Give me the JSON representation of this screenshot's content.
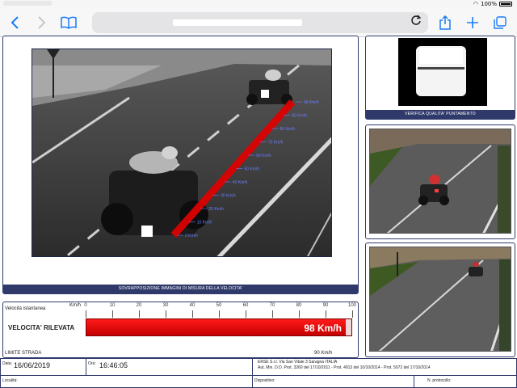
{
  "status": {
    "battery": "100%"
  },
  "toolbar": {
    "back_icon": "chevron-left-icon",
    "forward_icon": "chevron-right-icon",
    "bookmarks_icon": "book-icon",
    "reload_icon": "reload-icon",
    "share_icon": "share-icon",
    "new_tab_icon": "plus-icon",
    "tabs_icon": "tabs-icon",
    "accent": "#1a7cf5"
  },
  "report": {
    "main_caption": "SOVRAPPOSIZIONE IMMAGINI DI MISURA DELLA VELOCITA'",
    "aim_caption": "VERIFICA QUALITA' PUNTAMENTO",
    "distance_labels": [
      "98 Km/h",
      "90 Km/h",
      "80 Km/h",
      "70 Km/h",
      "60 Km/h",
      "50 Km/h",
      "40 Km/h",
      "30 Km/h",
      "20 Km/h",
      "10 Km/h",
      "0 Km/h"
    ],
    "instant_speed_label": "Velocità istantanea",
    "kmh_label": "Km/h",
    "scale_ticks": [
      "0",
      "10",
      "20",
      "30",
      "40",
      "50",
      "60",
      "70",
      "80",
      "90",
      "100"
    ],
    "detected_label": "VELOCITA' RILEVATA",
    "detected_value": "98 Km/h",
    "detected_fraction": 0.98,
    "limit_label": "LIMITE STRADA",
    "limit_value": "90 Km/h",
    "limit_fraction": 0.9,
    "date_label": "Data:",
    "date_value": "16/06/2019",
    "time_label": "Ora:",
    "time_value": "16:46:05",
    "company_line1": "ERSE S.r.l. Via San Vitale 3 Saragna ITALIA",
    "company_line2": "Aut. Min. D.D. Prot. 3260 del 17/10/2011 - Prot. 4913 del 10/10/2014 - Prot. 5072 del 17/10/2014",
    "location_label": "Località:",
    "operator_label": "Dispositivo:",
    "protocol_label": "N. protocollo:",
    "bar_color": "#d40000",
    "frame_color": "#2f3a6b"
  }
}
